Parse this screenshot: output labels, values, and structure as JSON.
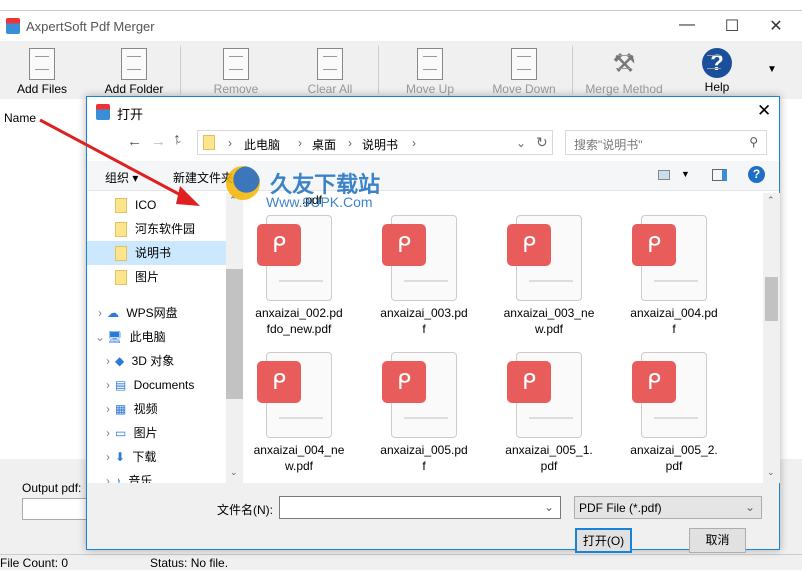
{
  "app": {
    "title": "AxpertSoft Pdf Merger",
    "window_controls": [
      "—",
      "☐",
      "✕"
    ],
    "toolbar": [
      {
        "label": "Add Files",
        "enabled": true,
        "icon": "add-files-icon"
      },
      {
        "label": "Add Folder",
        "enabled": true,
        "icon": "add-folder-icon"
      },
      {
        "label": "Remove",
        "enabled": false,
        "icon": "remove-icon"
      },
      {
        "label": "Clear All",
        "enabled": false,
        "icon": "clear-all-icon"
      },
      {
        "label": "Move Up",
        "enabled": false,
        "icon": "move-up-icon"
      },
      {
        "label": "Move Down",
        "enabled": false,
        "icon": "move-down-icon"
      },
      {
        "label": "Merge Method",
        "enabled": false,
        "icon": "merge-method-icon"
      },
      {
        "label": "Help",
        "enabled": true,
        "icon": "help-icon"
      }
    ],
    "list_header": "Name",
    "output_label": "Output pdf:",
    "file_count": "File Count: 0",
    "status": "Status: No file."
  },
  "dialog": {
    "title": "打开",
    "breadcrumb": [
      "此电脑",
      "桌面",
      "说明书"
    ],
    "search_placeholder": "搜索\"说明书\"",
    "organize": "组织 ▾",
    "new_folder": "新建文件夹",
    "nav": [
      {
        "label": "ICO",
        "indent": 1,
        "type": "folder"
      },
      {
        "label": "河东软件园",
        "indent": 1,
        "type": "folder"
      },
      {
        "label": "说明书",
        "indent": 1,
        "type": "folder",
        "selected": true
      },
      {
        "label": "图片",
        "indent": 1,
        "type": "folder"
      },
      {
        "label": "WPS网盘",
        "indent": 0,
        "type": "cloud"
      },
      {
        "label": "此电脑",
        "indent": 0,
        "type": "pc",
        "expanded": true
      },
      {
        "label": "3D 对象",
        "indent": 1,
        "type": "3d"
      },
      {
        "label": "Documents",
        "indent": 1,
        "type": "docs"
      },
      {
        "label": "视频",
        "indent": 1,
        "type": "video"
      },
      {
        "label": "图片",
        "indent": 1,
        "type": "pictures"
      },
      {
        "label": "下载",
        "indent": 1,
        "type": "download"
      },
      {
        "label": "音乐",
        "indent": 1,
        "type": "music"
      }
    ],
    "partial_top": ".pdf",
    "files": [
      [
        "anxaizai_002.pd",
        "fdo_new.pdf"
      ],
      [
        "anxaizai_003.pd",
        "f"
      ],
      [
        "anxaizai_003_ne",
        "w.pdf"
      ],
      [
        "anxaizai_004.pd",
        "f"
      ],
      [
        "anxaizai_004_ne",
        "w.pdf"
      ],
      [
        "anxaizai_005.pd",
        "f"
      ],
      [
        "anxaizai_005_1.",
        "pdf"
      ],
      [
        "anxaizai_005_2.",
        "pdf"
      ]
    ],
    "filename_label": "文件名(N):",
    "filename_value": "",
    "filetype": "PDF File (*.pdf)",
    "open": "打开(O)",
    "cancel": "取消"
  },
  "watermark": {
    "text": "久友下载站",
    "url": "Www.9UPK.Com"
  },
  "colors": {
    "accent": "#1883d7",
    "pdf_red": "#e85c5c",
    "arrow": "#e02020"
  }
}
